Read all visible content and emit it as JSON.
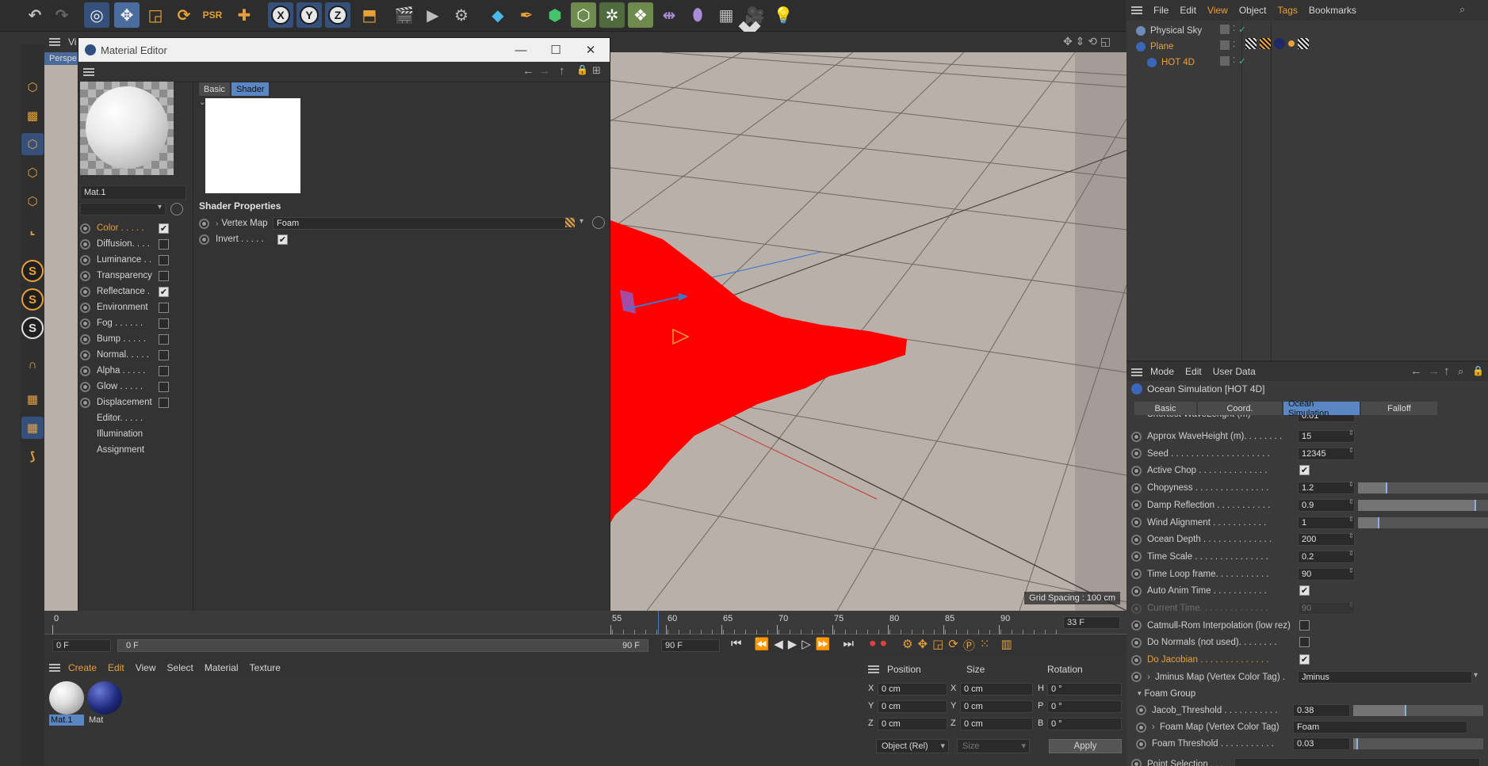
{
  "material_editor": {
    "title": "Material Editor",
    "material_name": "Mat.1",
    "tabs": [
      "Basic",
      "Shader"
    ],
    "channels": [
      {
        "label": "Color . . . . .",
        "checked": true,
        "active": true
      },
      {
        "label": "Diffusion. . . .",
        "checked": false
      },
      {
        "label": "Luminance . .",
        "checked": false
      },
      {
        "label": "Transparency",
        "checked": false
      },
      {
        "label": "Reflectance .",
        "checked": true
      },
      {
        "label": "Environment",
        "checked": false
      },
      {
        "label": "Fog . . . . . .",
        "checked": false
      },
      {
        "label": "Bump . . . . .",
        "checked": false
      },
      {
        "label": "Normal. . . . .",
        "checked": false
      },
      {
        "label": "Alpha . . . . .",
        "checked": false
      },
      {
        "label": "Glow . . . . .",
        "checked": false
      },
      {
        "label": "Displacement",
        "checked": false
      }
    ],
    "extra_items": [
      "Editor. . . . .",
      "Illumination",
      "Assignment"
    ],
    "shader_properties_heading": "Shader Properties",
    "vertex_map_label": "Vertex Map",
    "vertex_map_value": "Foam",
    "invert_label": "Invert . . . . .",
    "viewport_label": "Perspe",
    "viewport_label2": "Vi"
  },
  "viewport": {
    "grid_spacing": "Grid Spacing : 100 cm"
  },
  "object_manager": {
    "menu": [
      "File",
      "Edit",
      "View",
      "Object",
      "Tags",
      "Bookmarks"
    ],
    "objects": [
      {
        "name": "Physical Sky",
        "color": "#d0d0d0"
      },
      {
        "name": "Plane",
        "color": "#e8a13a"
      },
      {
        "name": "HOT 4D",
        "color": "#e8a13a"
      }
    ]
  },
  "attribute_manager": {
    "menu": [
      "Mode",
      "Edit",
      "User Data"
    ],
    "object_title": "Ocean Simulation [HOT 4D]",
    "tabs": [
      "Basic",
      "Coord.",
      "Ocean Simulation",
      "Falloff"
    ],
    "partial_row": {
      "label": "Shortest WaveLenght (m)",
      "value": "0.01"
    },
    "rows": [
      {
        "label": "Approx WaveHeight (m). . . . . . . .",
        "value": "15"
      },
      {
        "label": "Seed . . . . . . . . . . . . . . . . . . . .",
        "value": "12345"
      },
      {
        "label": "Active Chop . . . . . . . . . . . . . .",
        "check": true
      },
      {
        "label": "Chopyness . . . . . . . . . . . . . . .",
        "value": "1.2",
        "slider": 0.22
      },
      {
        "label": "Damp Reflection . . . . . . . . . . .",
        "value": "0.9",
        "slider": 0.9
      },
      {
        "label": "Wind Alignment . . . . . . . . . . .",
        "value": "1",
        "slider": 0.16
      },
      {
        "label": "Ocean Depth . . . . . . . . . . . . . .",
        "value": "200"
      },
      {
        "label": "Time Scale . . . . . . . . . . . . . . .",
        "value": "0.2"
      },
      {
        "label": "Time Loop frame. . . . . . . . . . .",
        "value": "90"
      },
      {
        "label": "Auto Anim Time . . . . . . . . . . .",
        "check": true
      },
      {
        "label": "Current Time. . . . . . . . . . . . . .",
        "value": "90",
        "disabled": true
      },
      {
        "label": "Catmull-Rom Interpolation (low rez)",
        "check": false
      },
      {
        "label": "Do Normals (not used). . . . . . . .",
        "check": false
      },
      {
        "label": "Do Jacobian . . . . . . . . . . . . . .",
        "check": true,
        "highlight": true
      }
    ],
    "jminus_label": "Jminus Map (Vertex Color Tag) .",
    "jminus_value": "Jminus",
    "foam_group_label": "Foam Group",
    "foam_rows": [
      {
        "label": "Jacob_Threshold . . . . . . . . . . .",
        "value": "0.38",
        "slider": 0.4
      },
      {
        "label": "Foam Map (Vertex Color Tag)",
        "value": "Foam",
        "field": true
      },
      {
        "label": "Foam Threshold . . . . . . . . . . .",
        "value": "0.03",
        "slider": 0.03
      }
    ],
    "point_selection_label": "Point Selection . . ."
  },
  "timeline": {
    "ticks": [
      "0",
      "55",
      "60",
      "65",
      "70",
      "75",
      "80",
      "85",
      "90"
    ],
    "current_frame": "33 F",
    "start_field": "0 F",
    "range_start": "0 F",
    "range_end": "90 F",
    "end_field": "90 F"
  },
  "material_manager": {
    "menu": [
      "Create",
      "Edit",
      "View",
      "Select",
      "Material",
      "Texture"
    ],
    "materials": [
      {
        "name": "Mat.1",
        "selected": true
      },
      {
        "name": "Mat",
        "selected": false
      }
    ]
  },
  "coord_manager": {
    "headers": [
      "Position",
      "Size",
      "Rotation"
    ],
    "rows": [
      {
        "axis": "X",
        "pos": "0 cm",
        "saxis": "X",
        "size": "0 cm",
        "raxis": "H",
        "rot": "0 °"
      },
      {
        "axis": "Y",
        "pos": "0 cm",
        "saxis": "Y",
        "size": "0 cm",
        "raxis": "P",
        "rot": "0 °"
      },
      {
        "axis": "Z",
        "pos": "0 cm",
        "saxis": "Z",
        "size": "0 cm",
        "raxis": "B",
        "rot": "0 °"
      }
    ],
    "mode": "Object (Rel)",
    "size_mode": "Size",
    "apply_label": "Apply"
  },
  "colors": {
    "accent_orange": "#e8a13a",
    "selection_blue": "#5a87c3",
    "plane_red": "#ff0000"
  }
}
